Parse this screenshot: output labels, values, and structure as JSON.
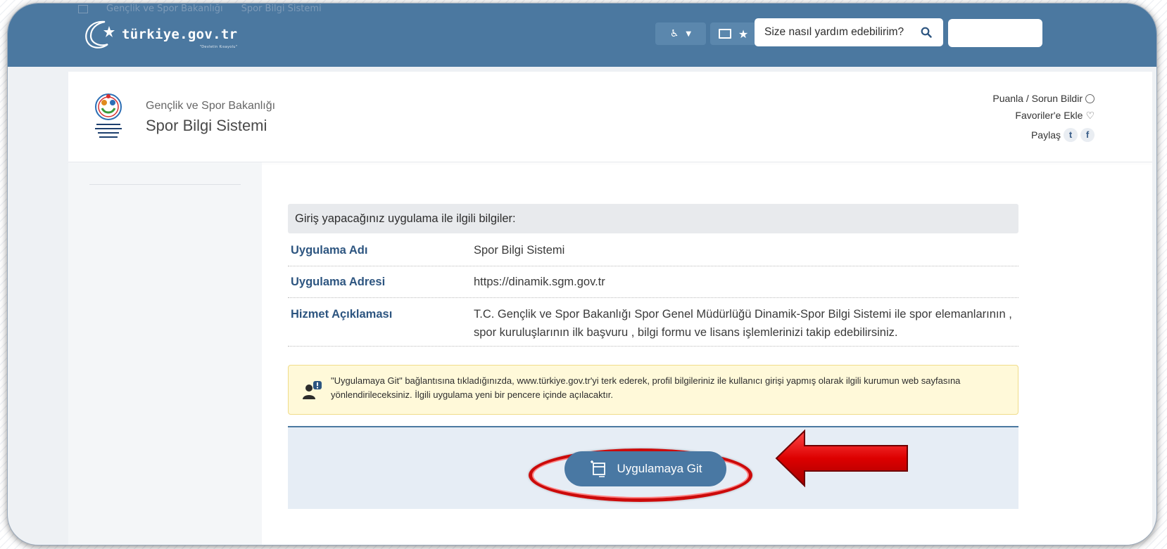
{
  "breadcrumb": [
    "Gençlik ve Spor Bakanlığı",
    "Spor Bilgi Sistemi"
  ],
  "logo_text": "türkiye.gov.tr",
  "logo_tagline": "\"Devletin Kısayolu\"",
  "search": {
    "placeholder": "Size nasıl yardım edebilirim?"
  },
  "institution": {
    "name": "Gençlik ve Spor Bakanlığı",
    "service": "Spor Bilgi Sistemi"
  },
  "actions": {
    "rate": "Puanla / Sorun Bildir",
    "favorite": "Favoriler'e Ekle",
    "share": "Paylaş"
  },
  "info": {
    "heading": "Giriş yapacağınız uygulama ile ilgili bilgiler:",
    "rows": [
      {
        "label": "Uygulama Adı",
        "value": "Spor Bilgi Sistemi"
      },
      {
        "label": "Uygulama Adresi",
        "value": "https://dinamik.sgm.gov.tr"
      },
      {
        "label": "Hizmet Açıklaması",
        "value": "T.C. Gençlik ve Spor Bakanlığı Spor Genel Müdürlüğü Dinamik-Spor Bilgi Sistemi ile spor elemanlarının , spor kuruluşlarının ilk başvuru , bilgi formu ve lisans işlemlerinizi takip edebilirsiniz."
      }
    ]
  },
  "notice": "\"Uygulamaya Git\" bağlantısına tıkladığınızda, www.türkiye.gov.tr'yi terk ederek, profil bilgileriniz ile kullanıcı girişi yapmış olarak ilgili kurumun web sayfasına yönlendirileceksiniz. İlgili uygulama yeni bir pencere içinde açılacaktır.",
  "go_button": "Uygulamaya Git",
  "colors": {
    "header": "#4b78a0",
    "label": "#2d5580",
    "highlight": "#cc0a0a",
    "notice_bg": "#fff9d9"
  }
}
